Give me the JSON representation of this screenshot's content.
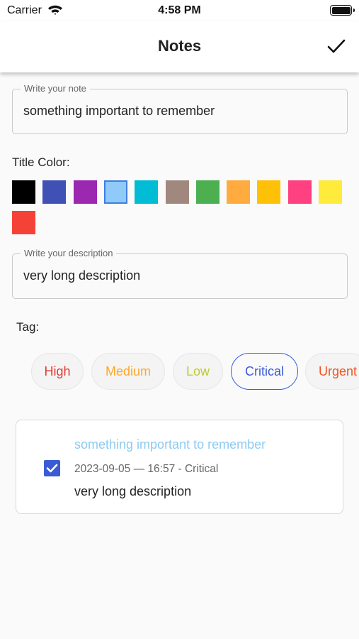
{
  "status_bar": {
    "carrier": "Carrier",
    "time": "4:58 PM",
    "wifi_icon": "wifi-icon",
    "battery_icon": "battery-full-icon"
  },
  "app_bar": {
    "title": "Notes",
    "confirm_icon": "checkmark-icon"
  },
  "note_field": {
    "label": "Write your note",
    "value": "something important to remember"
  },
  "title_color": {
    "label": "Title Color:",
    "selected": "light-blue",
    "swatches": [
      {
        "name": "black",
        "color": "#000000"
      },
      {
        "name": "indigo",
        "color": "#3f51b5"
      },
      {
        "name": "purple",
        "color": "#9c27b0"
      },
      {
        "name": "light-blue",
        "color": "#90caf9"
      },
      {
        "name": "cyan",
        "color": "#00bcd4"
      },
      {
        "name": "brown",
        "color": "#a1887f"
      },
      {
        "name": "green",
        "color": "#4caf50"
      },
      {
        "name": "orange",
        "color": "#ffab40"
      },
      {
        "name": "amber",
        "color": "#ffc107"
      },
      {
        "name": "pink",
        "color": "#ff4081"
      },
      {
        "name": "yellow",
        "color": "#ffeb3b"
      },
      {
        "name": "red",
        "color": "#f44336"
      }
    ]
  },
  "description_field": {
    "label": "Write your description",
    "value": "very long description"
  },
  "tag": {
    "label": "Tag:",
    "selected": "Critical",
    "options": [
      {
        "label": "High",
        "color": "#e53935"
      },
      {
        "label": "Medium",
        "color": "#ffa726"
      },
      {
        "label": "Low",
        "color": "#c0ca33"
      },
      {
        "label": "Critical",
        "color": "#3b5bd6"
      },
      {
        "label": "Urgent",
        "color": "#f4511e"
      }
    ]
  },
  "note_card": {
    "title": "something important to remember",
    "title_color": "#8ecbf0",
    "meta": "2023-09-05 — 16:57 - Critical",
    "description": "very long description",
    "checked": true
  }
}
